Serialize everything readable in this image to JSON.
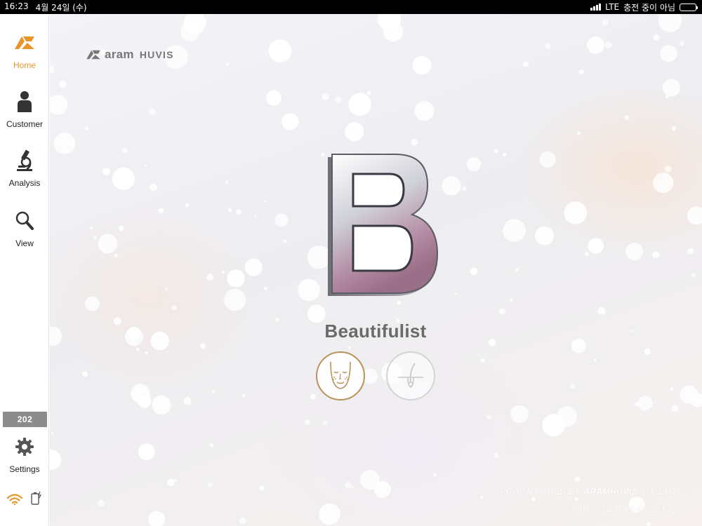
{
  "status_bar": {
    "time": "16:23",
    "date": "4월 24일 (수)",
    "network": "LTE",
    "charging": "충전 중이 아님",
    "signal_icon": "signal-bars-icon",
    "battery_icon": "battery-icon"
  },
  "sidebar": {
    "items": [
      {
        "label": "Home",
        "icon": "home-logo-icon",
        "active": true
      },
      {
        "label": "Customer",
        "icon": "person-icon"
      },
      {
        "label": "Analysis",
        "icon": "microscope-icon"
      },
      {
        "label": "View",
        "icon": "magnifier-icon"
      }
    ],
    "badge": "202",
    "settings_label": "Settings",
    "bottom_icons": [
      "wifi-icon",
      "device-charging-icon"
    ]
  },
  "main": {
    "brand": {
      "aram": "aram",
      "huvis": "HUVIS"
    },
    "big_letter": "B",
    "app_title": "Beautifulist",
    "modes": [
      {
        "name": "face",
        "icon": "face-icon"
      },
      {
        "name": "hair",
        "icon": "hair-follicle-icon"
      }
    ],
    "credits": {
      "prefix": "PROGRAMMED BY",
      "company": "ARAMHUVIS",
      "suffix": "CO.,LTD"
    },
    "version": "V 6 (Mar 14 2019 03:25:54)"
  },
  "colors": {
    "accent": "#e8962c",
    "face_ring": "#b8935a",
    "badge": "#8c8c8c"
  }
}
